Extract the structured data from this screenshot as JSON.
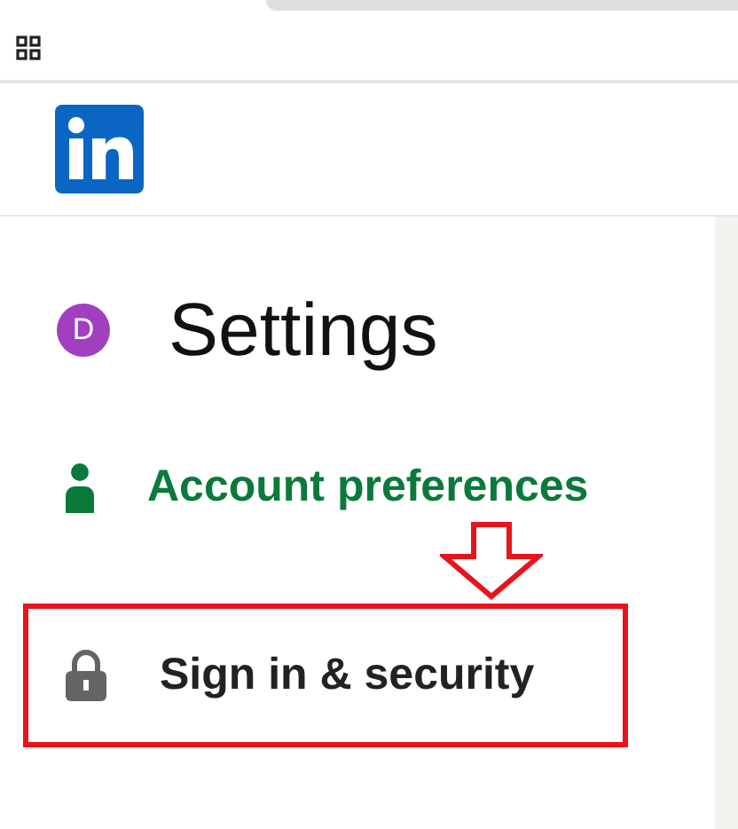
{
  "header": {
    "avatar_letter": "D",
    "title": "Settings"
  },
  "menu": [
    {
      "label": "Account preferences",
      "selected": true,
      "kind": "person",
      "annotated": false
    },
    {
      "label": "Sign in & security",
      "selected": false,
      "kind": "lock",
      "annotated": true
    }
  ]
}
